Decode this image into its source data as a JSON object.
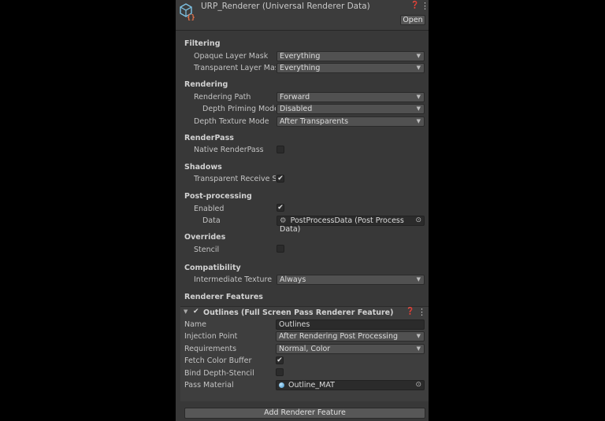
{
  "header": {
    "title": "URP_Renderer (Universal Renderer Data)",
    "help_icon": "help-icon",
    "menu_icon": "kebab-menu-icon",
    "open_label": "Open"
  },
  "filtering": {
    "section": "Filtering",
    "opaque_label": "Opaque Layer Mask",
    "opaque_value": "Everything",
    "transparent_label": "Transparent Layer Mask",
    "transparent_value": "Everything"
  },
  "rendering": {
    "section": "Rendering",
    "path_label": "Rendering Path",
    "path_value": "Forward",
    "depth_priming_label": "Depth Priming Mode",
    "depth_priming_value": "Disabled",
    "depth_texture_label": "Depth Texture Mode",
    "depth_texture_value": "After Transparents"
  },
  "renderpass": {
    "section": "RenderPass",
    "native_label": "Native RenderPass",
    "native_checked": false
  },
  "shadows": {
    "section": "Shadows",
    "receive_label": "Transparent Receive Shadows",
    "receive_checked": true
  },
  "post_processing": {
    "section": "Post-processing",
    "enabled_label": "Enabled",
    "enabled_checked": true,
    "data_label": "Data",
    "data_value": "PostProcessData (Post Process Data)"
  },
  "overrides": {
    "section": "Overrides",
    "stencil_label": "Stencil",
    "stencil_checked": false
  },
  "compatibility": {
    "section": "Compatibility",
    "intermediate_label": "Intermediate Texture",
    "intermediate_value": "Always"
  },
  "renderer_features": {
    "section": "Renderer Features",
    "feature_title": "Outlines (Full Screen Pass Renderer Feature)",
    "name_label": "Name",
    "name_value": "Outlines",
    "injection_label": "Injection Point",
    "injection_value": "After Rendering Post Processing",
    "requirements_label": "Requirements",
    "requirements_value": "Normal, Color",
    "fetch_label": "Fetch Color Buffer",
    "fetch_checked": true,
    "bind_label": "Bind Depth-Stencil",
    "bind_checked": false,
    "material_label": "Pass Material",
    "material_value": "Outline_MAT",
    "add_label": "Add Renderer Feature"
  },
  "glyphs": {
    "check": "✔",
    "arrow": "▼",
    "target": "⊙",
    "help": "❓",
    "menu": "⋮",
    "foldout": "▼"
  },
  "colors": {
    "panel_bg": "#383838",
    "page_bg": "#000000",
    "field_bg": "#515151",
    "object_field_bg": "#2b2b2b"
  }
}
